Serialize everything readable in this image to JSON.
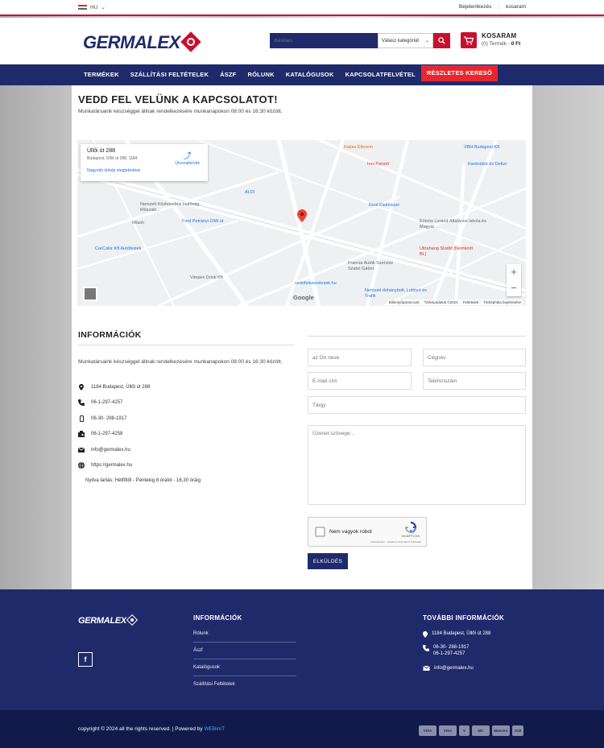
{
  "topbar": {
    "lang": "HU",
    "login": "Bejelentkezés",
    "cart": "kosaram"
  },
  "header": {
    "search_placeholder": "Keresés",
    "category_placeholder": "Válasz kategóriát",
    "cart_title": "KOSARAM",
    "cart_count": "(0) Termék -",
    "cart_total": "0 Ft"
  },
  "nav": [
    "TERMÉKEK",
    "SZÁLLÍTÁSI FELTÉTELEK",
    "ÁSZF",
    "RÓLUNK",
    "KATALÓGUSOK",
    "KAPCSOLATFELVÉTEL",
    "RÉSZLETES KERESŐ"
  ],
  "page": {
    "title": "VEDD FEL VELÜNK A KAPCSOLATOT!",
    "subtitle": "Munkatársaink készséggel állnak rendelkezésére munkanapokon 08:00 és 16:30 között."
  },
  "map": {
    "place_name": "Üllői út 288",
    "place_address": "Budapest, Üllői út 288, 1184",
    "directions": "Útvonaltervek",
    "larger_map": "Nagyobb térkép megtekintése",
    "labels": [
      {
        "t": "Kakas Étterem",
        "c": "#e37400"
      },
      {
        "t": "VBH Budapest Kft",
        "c": "#1a73e8"
      },
      {
        "t": "Inni Panzió",
        "c": "#d93025"
      },
      {
        "t": "Kardoskút és Dekor",
        "c": "#1a73e8"
      },
      {
        "t": "ALDI",
        "c": "#1a73e8"
      },
      {
        "t": "Nemzeti Közlekedési Hatóság, Műszaki...",
        "c": "#666"
      },
      {
        "t": "Real Élelmiszer",
        "c": "#1a73e8"
      },
      {
        "t": "Eötvös Loránd Általános Iskola és Magyar...",
        "c": "#666"
      },
      {
        "t": "Ford Petrányi Üllői út",
        "c": "#1a73e8"
      },
      {
        "t": "iWash",
        "c": "#666"
      },
      {
        "t": "Ultrahang Stúdió [Nemkorit Bt.]",
        "c": "#d93025"
      },
      {
        "t": "CarColor Kft Autófesték",
        "c": "#1a73e8"
      },
      {
        "t": "Francia Autók Szervize Szabó Gábor",
        "c": "#666"
      },
      {
        "t": "Vimpex Drink Kft",
        "c": "#666"
      },
      {
        "t": "vedofelszerelesek.hu",
        "c": "#1a73e8"
      },
      {
        "t": "Nemzeti dohánybolt, Lottózó és Trafik",
        "c": "#1a73e8"
      }
    ],
    "footer": [
      "Billentyűparancsok",
      "Térképadatok ©2024",
      "Feltételek",
      "Térképhiba bejelentése"
    ],
    "brand": "Google"
  },
  "info": {
    "heading": "INFORMÁCIÓK",
    "text": "Munkatársaink készséggel állnak rendelkezésére munkanapokon 08:00 és 16:30 között.",
    "address": "1184 Budapest, Üllői út 288",
    "phone": "06-1-297-4257",
    "mobile": "06-30- 288-1917",
    "fax": "06-1-297-4258",
    "email": "info@germalex.hu",
    "web": "https://germalex.hu",
    "hours": "Nyitva tartás: Hétfőtől - Péntekig 8 órától - 16,30 óráig"
  },
  "form": {
    "name": "az Ön neve",
    "company": "Cégnév",
    "email": "E-mail cím",
    "phone": "Telefonszám",
    "subject": "Tárgy",
    "message": "Üzenet szövege...",
    "captcha": "Nem vagyok robot",
    "captcha_brand": "reCAPTCHA",
    "captcha_terms": "Adatvédelem – Általános Szerződési Feltételek",
    "submit": "ELKÜLDÉS"
  },
  "footer": {
    "info_heading": "INFORMÁCIÓK",
    "links": [
      "Rólunk",
      "Ászf",
      "Katalógusok",
      "Szállítási Feltételek"
    ],
    "more_heading": "TOVÁBBI INFORMÁCIÓK",
    "address": "1184 Budapest, Üllői út 288",
    "phone1": "06-30- 288-1917",
    "phone2": "06-1-297-4257",
    "email": "info@germalex.hu",
    "facebook": "f",
    "copyright": "copyright © 2024 all the rights reserved. | Powered by",
    "powered": "WEBinIT",
    "cards": [
      "VISA",
      "VISA",
      "V",
      "MC",
      "Maestro",
      "JCB"
    ]
  },
  "colors": {
    "brand_blue": "#1f2a6b",
    "brand_red": "#c8102e"
  }
}
